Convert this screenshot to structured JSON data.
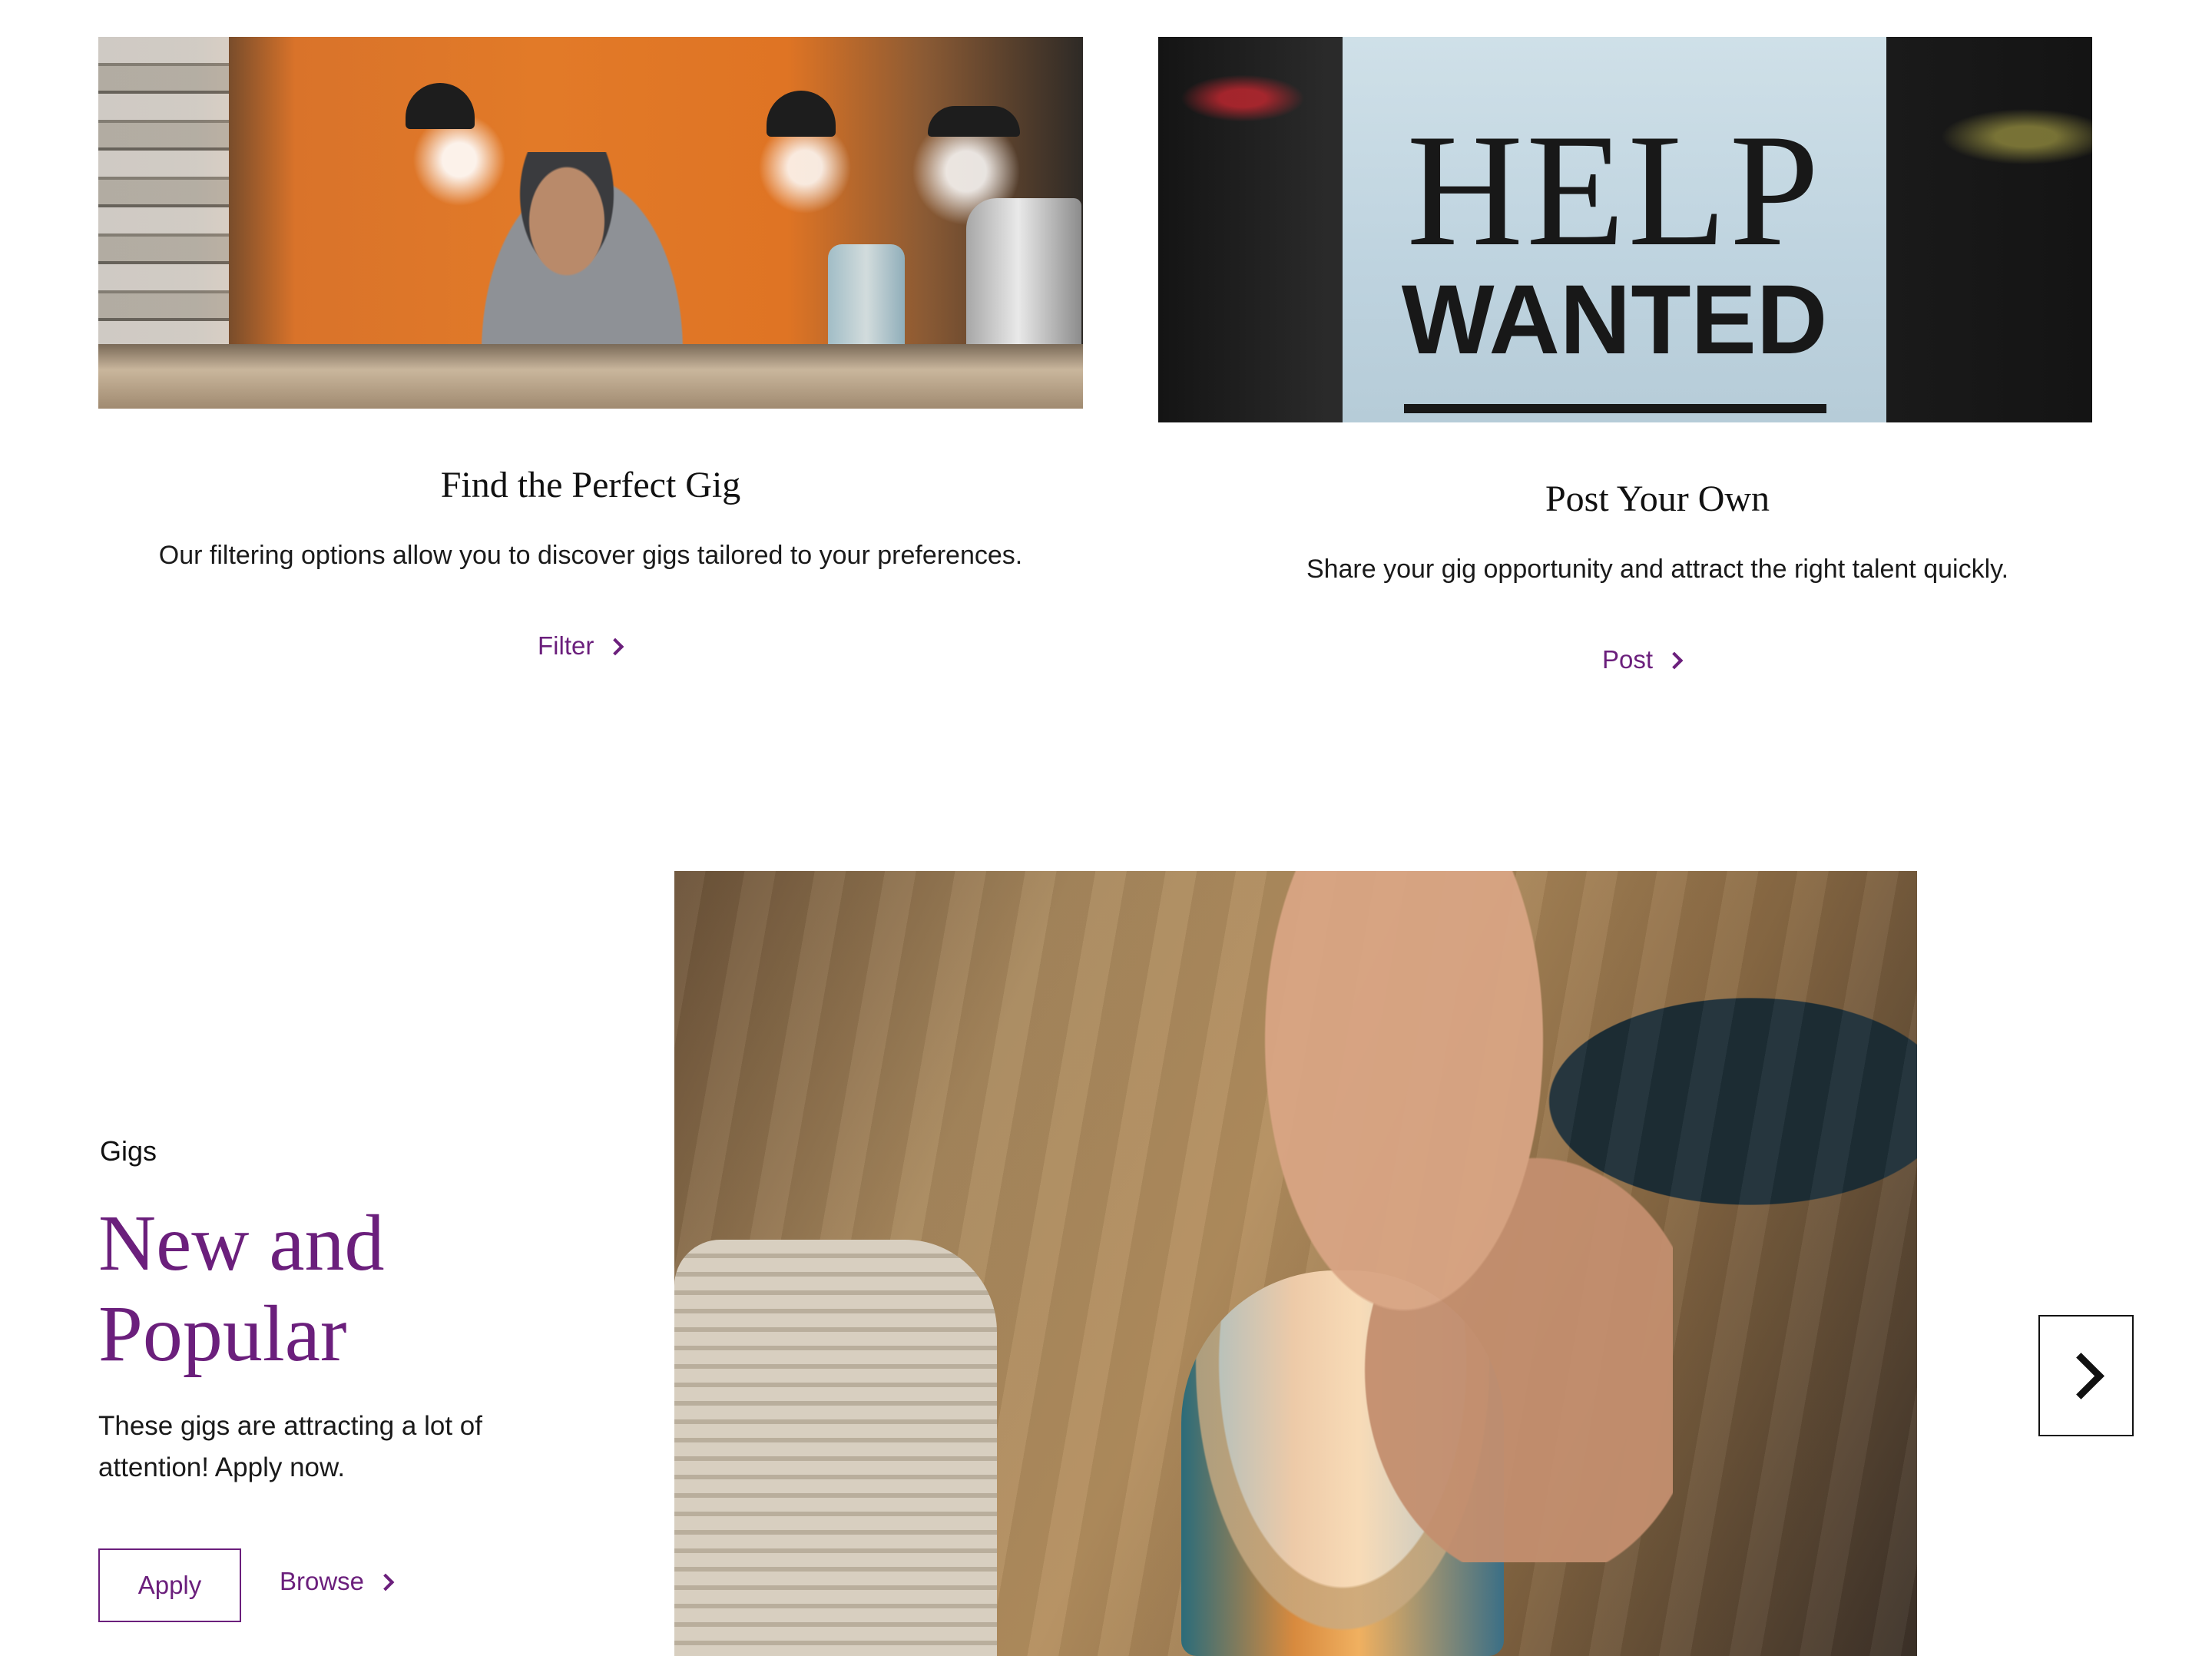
{
  "cards": [
    {
      "title": "Find the Perfect Gig",
      "description": "Our filtering options allow you to discover gigs tailored to your preferences.",
      "link_label": "Filter"
    },
    {
      "title": "Post Your Own",
      "description": "Share your gig opportunity and attract the right talent quickly.",
      "link_label": "Post",
      "image_sign": {
        "line1": "HELP",
        "line2": "WANTED"
      }
    }
  ],
  "gigs": {
    "eyebrow": "Gigs",
    "title": "New and Popular",
    "description": "These gigs are attracting a lot of attention! Apply now.",
    "apply_label": "Apply",
    "browse_label": "Browse"
  },
  "icons": {
    "link_chevron": "chevron-right-icon",
    "carousel_next": "arrow-right-icon"
  },
  "colors": {
    "accent": "#6b1f7c",
    "text": "#1a1a1a",
    "background": "#ffffff"
  }
}
